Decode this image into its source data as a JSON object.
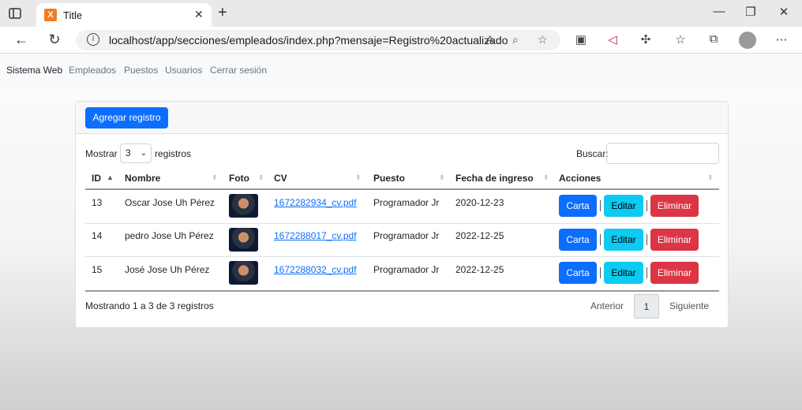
{
  "browser": {
    "tab_title": "Title",
    "tab_favicon": "X",
    "url": "localhost/app/secciones/empleados/index.php?mensaje=Registro%20actualizado"
  },
  "navbar": {
    "brand": "Sistema Web",
    "links": [
      "Empleados",
      "Puestos",
      "Usuarios",
      "Cerrar sesión"
    ]
  },
  "toolbar": {
    "add_label": "Agregar registro"
  },
  "table_controls": {
    "show_label": "Mostrar",
    "page_size": "3",
    "records_label": "registros",
    "search_label": "Buscar:",
    "search_value": ""
  },
  "table": {
    "headers": [
      "ID",
      "Nombre",
      "Foto",
      "CV",
      "Puesto",
      "Fecha de ingreso",
      "Acciones"
    ],
    "rows": [
      {
        "id": "13",
        "nombre": "Oscar Jose Uh Pérez",
        "cv": "1672282934_cv.pdf",
        "puesto": "Programador Jr",
        "fecha": "2020-12-23"
      },
      {
        "id": "14",
        "nombre": "pedro Jose Uh Pérez",
        "cv": "1672288017_cv.pdf",
        "puesto": "Programador Jr",
        "fecha": "2022-12-25"
      },
      {
        "id": "15",
        "nombre": "José Jose Uh Pérez",
        "cv": "1672288032_cv.pdf",
        "puesto": "Programador Jr",
        "fecha": "2022-12-25"
      }
    ],
    "actions": {
      "carta": "Carta",
      "editar": "Editar",
      "eliminar": "Eliminar"
    }
  },
  "footer": {
    "info": "Mostrando 1 a 3 de 3 registros",
    "prev": "Anterior",
    "page": "1",
    "next": "Siguiente"
  },
  "colors": {
    "primary": "#0d6efd",
    "info": "#0dcaf0",
    "danger": "#dc3545"
  }
}
